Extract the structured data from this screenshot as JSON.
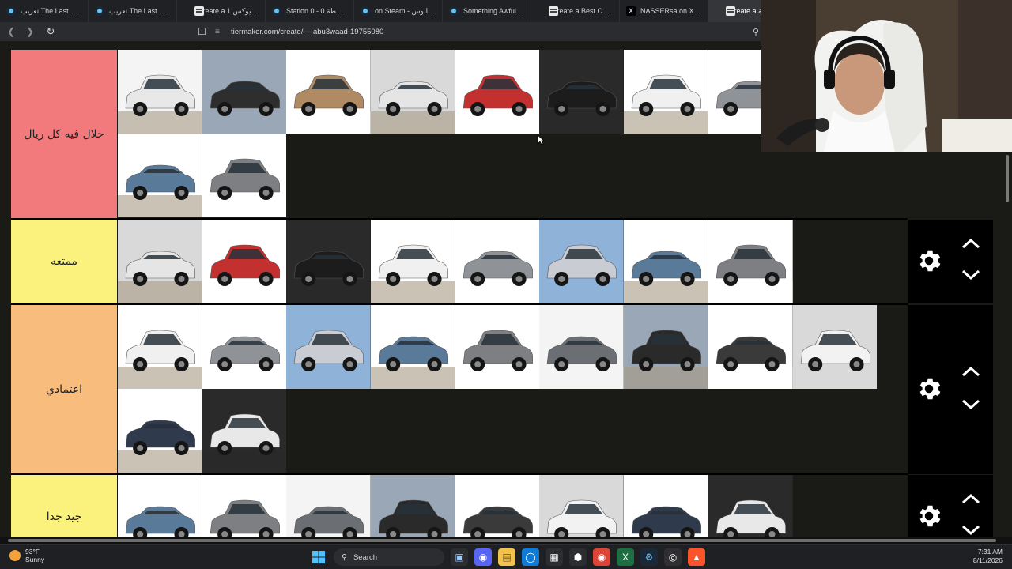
{
  "browser": {
    "tabs": [
      {
        "label": "تعريب The Last Of Us",
        "icon": "steam"
      },
      {
        "label": "تعريب The Last Of Us",
        "icon": "steam"
      },
      {
        "label": "Create a 1 الأكسيوكس",
        "icon": "tier"
      },
      {
        "label": "Station 0 - 0 المحطة",
        "icon": "steam"
      },
      {
        "label": "on Steam - ابو قانوس",
        "icon": "steam"
      },
      {
        "label": "Something Awful: Sto",
        "icon": "steam"
      },
      {
        "label": "Create a Best Cars Ti",
        "icon": "tier"
      },
      {
        "label": "NASSERsa on X: \"@3_",
        "icon": "x"
      },
      {
        "label": "Create a قائمة",
        "icon": "tier",
        "active": true
      }
    ],
    "url": "tiermaker.com/create/----abu3waad-19755080"
  },
  "tiers": [
    {
      "label": "حلال فيه كل ريال",
      "color": "#f27a7d",
      "count": 11
    },
    {
      "label": "ممتعه",
      "color": "#faf27d",
      "count": 8
    },
    {
      "label": "اعتمادي",
      "color": "#f8bc7d",
      "count": 11
    },
    {
      "label": "جيد جدا",
      "color": "#faf27d",
      "count": 8
    }
  ],
  "taskbar": {
    "weather_temp": "93°F",
    "weather_desc": "Sunny",
    "search_label": "Search",
    "time": "7:31 AM",
    "date": "8/11/2026"
  }
}
